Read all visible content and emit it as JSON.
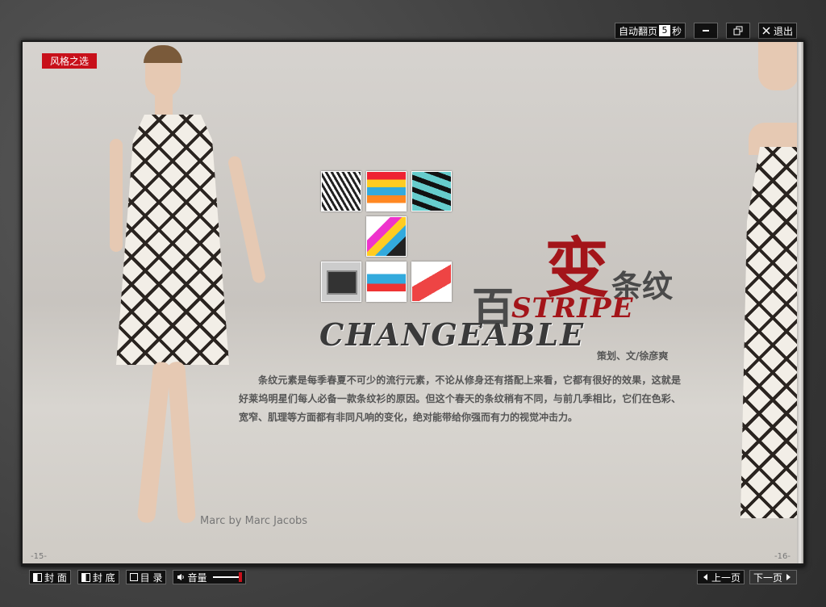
{
  "toolbar": {
    "auto_flip_label": "自动翻页",
    "seconds_value": "5",
    "seconds_unit": "秒",
    "minimize_icon": "minus-icon",
    "restore_icon": "restore-icon",
    "exit_label": "退出"
  },
  "page_left": {
    "tag": "风格之选",
    "title_bai": "百",
    "title_bian": "变",
    "title_tiaowen": "条纹",
    "title_stripe": "STRIPE",
    "title_changeable": "CHANGEABLE",
    "byline": "策划、文/徐彦爽",
    "body": "条纹元素是每季春夏不可少的流行元素，不论从修身还有搭配上来看，它都有很好的效果，这就是好莱坞明星们每人必备一款条纹衫的原因。但这个春天的条纹稍有不同，与前几季相比，它们在色彩、宽窄、肌理等方面都有非同凡响的变化，绝对能带给你强而有力的视觉冲击力。",
    "caption": "Marc by Marc Jacobs",
    "page_number": "-15-"
  },
  "page_right": {
    "page_number": "-16-"
  },
  "bottom": {
    "cover": "封 面",
    "back_cover": "封 底",
    "toc": "目 录",
    "volume": "音量",
    "prev": "上一页",
    "next": "下一页"
  },
  "colors": {
    "accent_red": "#c8101a",
    "title_red": "#a3151a"
  }
}
